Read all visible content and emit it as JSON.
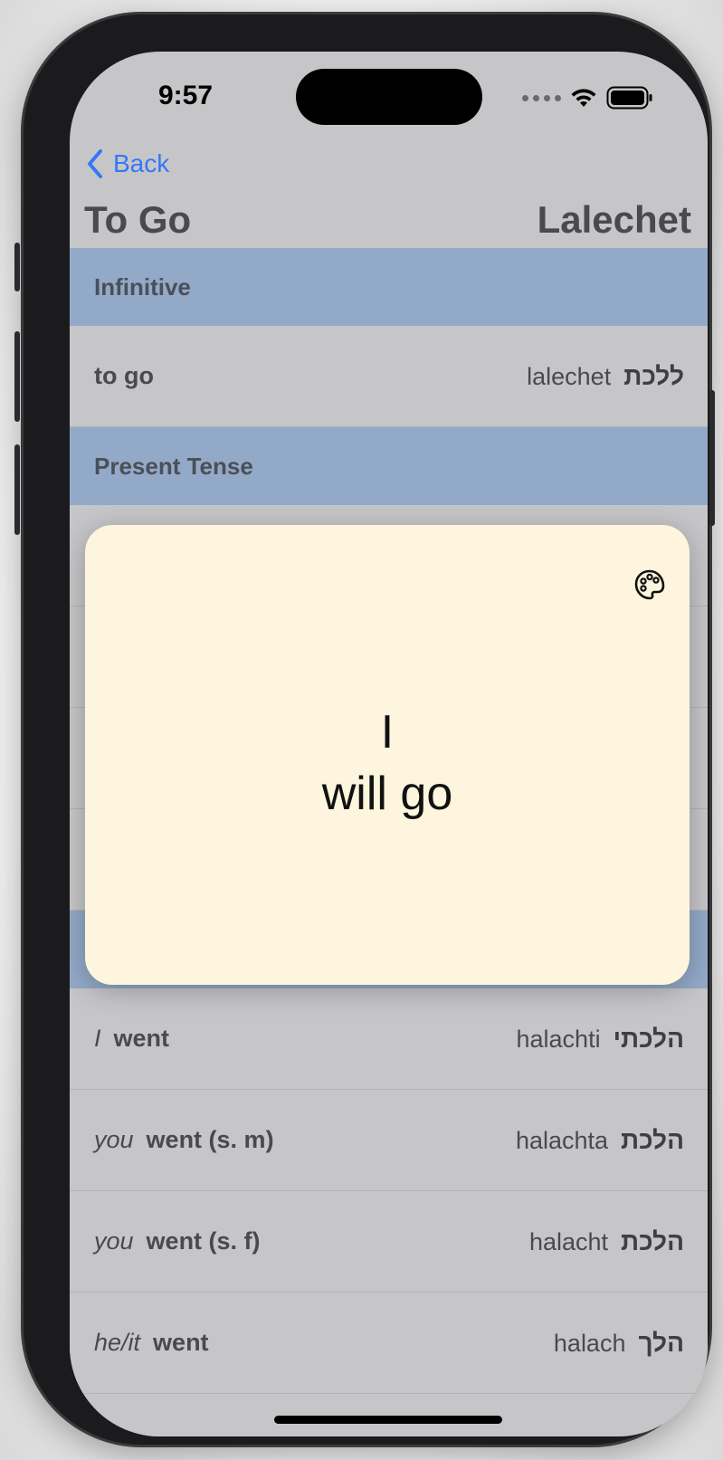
{
  "status_bar": {
    "time": "9:57"
  },
  "nav": {
    "back_label": "Back"
  },
  "header": {
    "title_english": "To Go",
    "title_transliteration": "Lalechet"
  },
  "sections": {
    "infinitive": "Infinitive",
    "present": "Present Tense"
  },
  "infinitive_row": {
    "english": "to go",
    "transliteration": "lalechet",
    "hebrew": "ללכת"
  },
  "past_rows": [
    {
      "pronoun": "I",
      "english": "went",
      "transliteration": "halachti",
      "hebrew": "הלכתי"
    },
    {
      "pronoun": "you",
      "english": "went (s. m)",
      "transliteration": "halachta",
      "hebrew": "הלכת"
    },
    {
      "pronoun": "you",
      "english": "went (s. f)",
      "transliteration": "halacht",
      "hebrew": "הלכת"
    },
    {
      "pronoun": "he/it",
      "english": "went",
      "transliteration": "halach",
      "hebrew": "הלך"
    }
  ],
  "flashcard": {
    "line1": "I",
    "line2": "will go",
    "background": "#fdf5dd"
  },
  "icons": {
    "back": "chevron-left-icon",
    "palette": "palette-icon",
    "wifi": "wifi-icon",
    "battery": "battery-icon"
  },
  "colors": {
    "accent": "#3478f6",
    "section_header": "#93a9c8"
  }
}
